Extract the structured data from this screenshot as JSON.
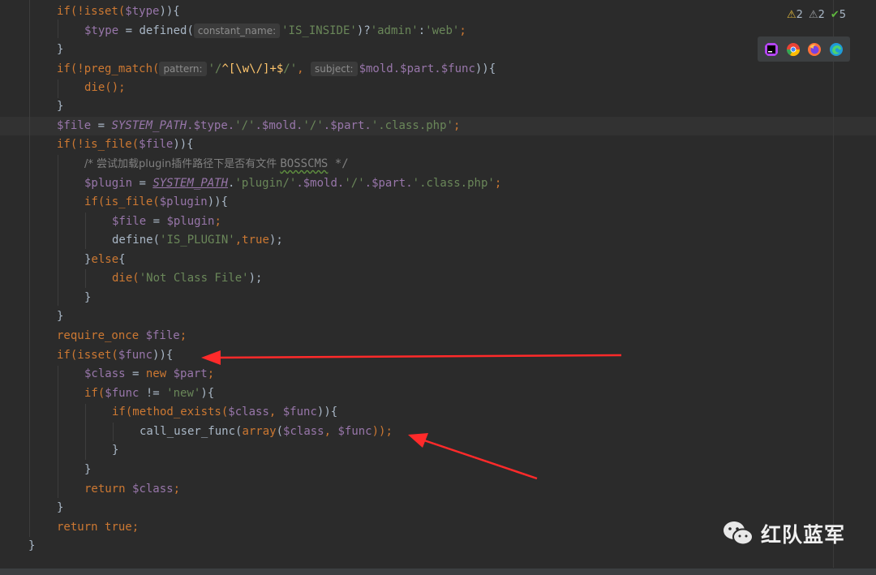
{
  "inspection": {
    "warnings_yellow": "2",
    "warnings_gray": "2",
    "ok_count": "5"
  },
  "browser_icons": [
    "phpstorm-icon",
    "chrome-icon",
    "firefox-icon",
    "edge-icon"
  ],
  "hints": {
    "constant_name": "constant_name:",
    "pattern": "pattern:",
    "subject": "subject:"
  },
  "code": {
    "l1_a": "if(!isset(",
    "l1_v": "$type",
    "l1_b": ")){",
    "l2_v": "$type",
    "l2_a": " = defined(",
    "l2_s1": "'IS_INSIDE'",
    "l2_b": ")?",
    "l2_s2": "'admin'",
    "l2_c": ":",
    "l2_s3": "'web'",
    "l2_d": ";",
    "l3": "}",
    "l4_a": "if(!preg_match(",
    "l4_rx1": "'/",
    "l4_rx2": "^[\\w\\/]+$",
    "l4_rx3": "/'",
    "l4_b": ",",
    "l4_v": "$mold.$part.$func",
    "l4_c": ")){",
    "l5": "die();",
    "l6": "}",
    "l7_v": "$file",
    "l7_a": " = ",
    "l7_c": "SYSTEM_PATH",
    "l7_b": ".$type.",
    "l7_s1": "'/'",
    "l7_d": ".$mold.",
    "l7_s2": "'/'",
    "l7_e": ".$part.",
    "l7_s3": "'.class.php'",
    "l7_f": ";",
    "l8_a": "if(!is_file(",
    "l8_v": "$file",
    "l8_b": ")){",
    "l9_a": "/* 尝试加载plugin插件路径下是否有文件 ",
    "l9_b": "BOSSCMS",
    "l9_c": " */",
    "l10_v": "$plugin",
    "l10_a": " = ",
    "l10_c": "SYSTEM_PATH",
    "l10_b": ".",
    "l10_s1": "'plugin/'",
    "l10_d": ".$mold.",
    "l10_s2": "'/'",
    "l10_e": ".$part.",
    "l10_s3": "'.class.php'",
    "l10_f": ";",
    "l11_a": "if(is_file(",
    "l11_v": "$plugin",
    "l11_b": ")){",
    "l12_v1": "$file",
    "l12_a": " = ",
    "l12_v2": "$plugin",
    "l12_b": ";",
    "l13_a": "define(",
    "l13_s": "'IS_PLUGIN'",
    "l13_b": ",",
    "l13_k": "true",
    "l13_c": ");",
    "l14_a": "}",
    "l14_k": "else",
    "l14_b": "{",
    "l15_a": "die(",
    "l15_s": "'Not Class File'",
    "l15_b": ");",
    "l16": "}",
    "l17": "}",
    "l18_k": "require_once ",
    "l18_v": "$file",
    "l18_b": ";",
    "l19_a": "if(isset(",
    "l19_v": "$func",
    "l19_b": ")){",
    "l20_v": "$class",
    "l20_a": " = ",
    "l20_k": "new ",
    "l20_v2": "$part",
    "l20_b": ";",
    "l21_a": "if(",
    "l21_v": "$func",
    "l21_b": " != ",
    "l21_s": "'new'",
    "l21_c": "){",
    "l22_a": "if(method_exists(",
    "l22_v1": "$class",
    "l22_b": ", ",
    "l22_v2": "$func",
    "l22_c": ")){",
    "l23_a": "call_user_func(",
    "l23_k": "array",
    "l23_b": "(",
    "l23_v1": "$class",
    "l23_c": ", ",
    "l23_v2": "$func",
    "l23_d": "));",
    "l24": "}",
    "l25": "}",
    "l26_k": "return ",
    "l26_v": "$class",
    "l26_b": ";",
    "l27": "}",
    "l28_k": "return ",
    "l28_k2": "true",
    "l28_b": ";",
    "l29": "}"
  },
  "watermark": {
    "text": "红队蓝军",
    "icon": "wechat-icon"
  },
  "colors": {
    "background": "#2b2b2b",
    "keyword": "#cc7832",
    "variable": "#9876aa",
    "string": "#6a8759",
    "annotation_arrow": "#ff2a2a"
  }
}
